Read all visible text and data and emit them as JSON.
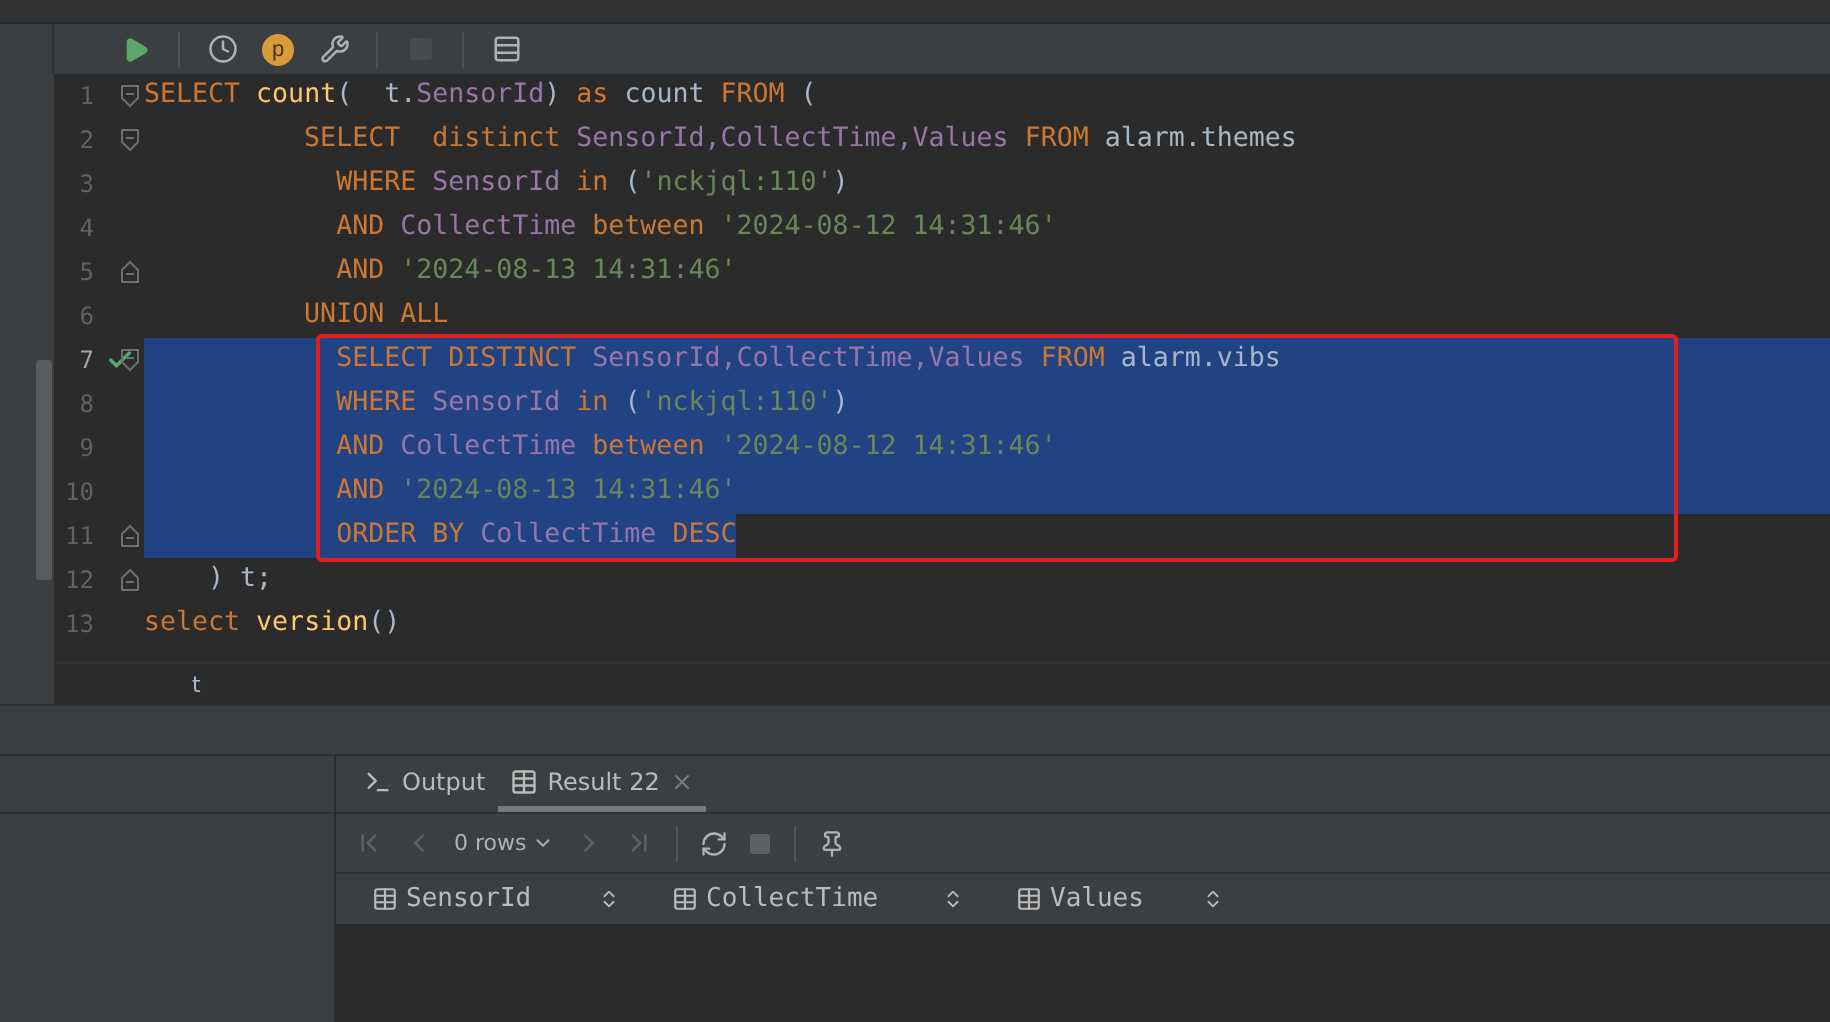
{
  "toolbar": {
    "buttons": [
      {
        "kind": "run",
        "disabled": false
      },
      {
        "kind": "history",
        "disabled": false
      },
      {
        "kind": "profile",
        "label": "p",
        "disabled": false
      },
      {
        "kind": "settings",
        "disabled": false
      },
      {
        "kind": "stop",
        "disabled": true
      },
      {
        "kind": "table",
        "disabled": false
      }
    ]
  },
  "editor": {
    "lines": [
      {
        "number": "1",
        "fold_marker": {
          "kind": "start"
        },
        "executed": false,
        "selected": false,
        "boxed": false,
        "tokens": [
          {
            "kind": "keyword",
            "text": "SELECT "
          },
          {
            "kind": "function",
            "text": "count"
          },
          {
            "kind": "plain",
            "text": "(  t."
          },
          {
            "kind": "column",
            "text": "SensorId"
          },
          {
            "kind": "plain",
            "text": ") "
          },
          {
            "kind": "keyword",
            "text": "as"
          },
          {
            "kind": "plain",
            "text": " count "
          },
          {
            "kind": "keyword",
            "text": "FROM"
          },
          {
            "kind": "plain",
            "text": " ("
          }
        ]
      },
      {
        "number": "2",
        "fold_marker": {
          "kind": "start"
        },
        "executed": false,
        "selected": false,
        "boxed": false,
        "tokens": [
          {
            "kind": "keyword",
            "text": "          SELECT  distinct "
          },
          {
            "kind": "column",
            "text": "SensorId,CollectTime,Values"
          },
          {
            "kind": "keyword",
            "text": " FROM"
          },
          {
            "kind": "plain",
            "text": " alarm.themes"
          }
        ]
      },
      {
        "number": "3",
        "executed": false,
        "selected": false,
        "boxed": false,
        "tokens": [
          {
            "kind": "keyword",
            "text": "            WHERE "
          },
          {
            "kind": "column",
            "text": "SensorId"
          },
          {
            "kind": "keyword",
            "text": " in"
          },
          {
            "kind": "plain",
            "text": " ("
          },
          {
            "kind": "string",
            "text": "'nckjql:110'"
          },
          {
            "kind": "plain",
            "text": ")"
          }
        ]
      },
      {
        "number": "4",
        "executed": false,
        "selected": false,
        "boxed": false,
        "tokens": [
          {
            "kind": "keyword",
            "text": "            AND "
          },
          {
            "kind": "column",
            "text": "CollectTime"
          },
          {
            "kind": "keyword",
            "text": " between"
          },
          {
            "kind": "string",
            "text": " '2024-08-12 14:31:46'"
          }
        ]
      },
      {
        "number": "5",
        "fold_marker": {
          "kind": "end"
        },
        "executed": false,
        "selected": false,
        "boxed": false,
        "tokens": [
          {
            "kind": "keyword",
            "text": "            AND"
          },
          {
            "kind": "string",
            "text": " '2024-08-13 14:31:46'"
          }
        ]
      },
      {
        "number": "6",
        "executed": false,
        "selected": false,
        "boxed": false,
        "tokens": [
          {
            "kind": "keyword",
            "text": "          UNION ALL"
          }
        ]
      },
      {
        "number": "7",
        "fold_marker": {
          "kind": "start"
        },
        "executed": true,
        "selected": true,
        "boxed": true,
        "tokens": [
          {
            "kind": "keyword",
            "text": "            SELECT DISTINCT "
          },
          {
            "kind": "column",
            "text": "SensorId,CollectTime,Values"
          },
          {
            "kind": "keyword",
            "text": " FROM"
          },
          {
            "kind": "plain",
            "text": " alarm.vibs"
          }
        ]
      },
      {
        "number": "8",
        "executed": false,
        "selected": true,
        "boxed": true,
        "tokens": [
          {
            "kind": "keyword",
            "text": "            WHERE "
          },
          {
            "kind": "column",
            "text": "SensorId"
          },
          {
            "kind": "keyword",
            "text": " in"
          },
          {
            "kind": "plain",
            "text": " ("
          },
          {
            "kind": "string",
            "text": "'nckjql:110'"
          },
          {
            "kind": "plain",
            "text": ")"
          }
        ]
      },
      {
        "number": "9",
        "executed": false,
        "selected": true,
        "boxed": true,
        "tokens": [
          {
            "kind": "keyword",
            "text": "            AND "
          },
          {
            "kind": "column",
            "text": "CollectTime"
          },
          {
            "kind": "keyword",
            "text": " between"
          },
          {
            "kind": "string",
            "text": " '2024-08-12 14:31:46'"
          }
        ]
      },
      {
        "number": "10",
        "executed": false,
        "selected": true,
        "boxed": true,
        "tokens": [
          {
            "kind": "keyword",
            "text": "            AND"
          },
          {
            "kind": "string",
            "text": " '2024-08-13 14:31:46'"
          }
        ]
      },
      {
        "number": "11",
        "fold_marker": {
          "kind": "end"
        },
        "executed": false,
        "selected": true,
        "boxed": true,
        "tokens": [
          {
            "kind": "keyword",
            "text": "            ORDER BY "
          },
          {
            "kind": "column",
            "text": "CollectTime"
          },
          {
            "kind": "keyword",
            "text": " DESC"
          }
        ]
      },
      {
        "number": "12",
        "fold_marker": {
          "kind": "end"
        },
        "executed": false,
        "selected": false,
        "boxed": false,
        "tokens": [
          {
            "kind": "plain",
            "text": "    ) t;"
          }
        ]
      },
      {
        "number": "13",
        "executed": false,
        "selected": false,
        "boxed": false,
        "tokens": [
          {
            "kind": "keyword",
            "text": "select "
          },
          {
            "kind": "function",
            "text": "version"
          },
          {
            "kind": "plain",
            "text": "()"
          }
        ]
      }
    ],
    "breadcrumb": "t"
  },
  "results": {
    "tabs": [
      {
        "label": "Output",
        "kind": "output",
        "selected": false,
        "closable": false
      },
      {
        "label": "Result 22",
        "kind": "table",
        "selected": true,
        "closable": true
      }
    ],
    "toolbar": [
      {
        "kind": "first",
        "disabled": true
      },
      {
        "kind": "previous",
        "disabled": true
      },
      {
        "kind": "rows",
        "label": "0 rows",
        "disabled": false
      },
      {
        "kind": "next",
        "disabled": true
      },
      {
        "kind": "last",
        "disabled": true
      },
      {
        "kind": "refresh",
        "disabled": false
      },
      {
        "kind": "stop",
        "disabled": true
      },
      {
        "kind": "pin",
        "disabled": false
      }
    ],
    "columns": [
      {
        "label": "SensorId"
      },
      {
        "label": "CollectTime"
      },
      {
        "label": "Values"
      }
    ]
  }
}
